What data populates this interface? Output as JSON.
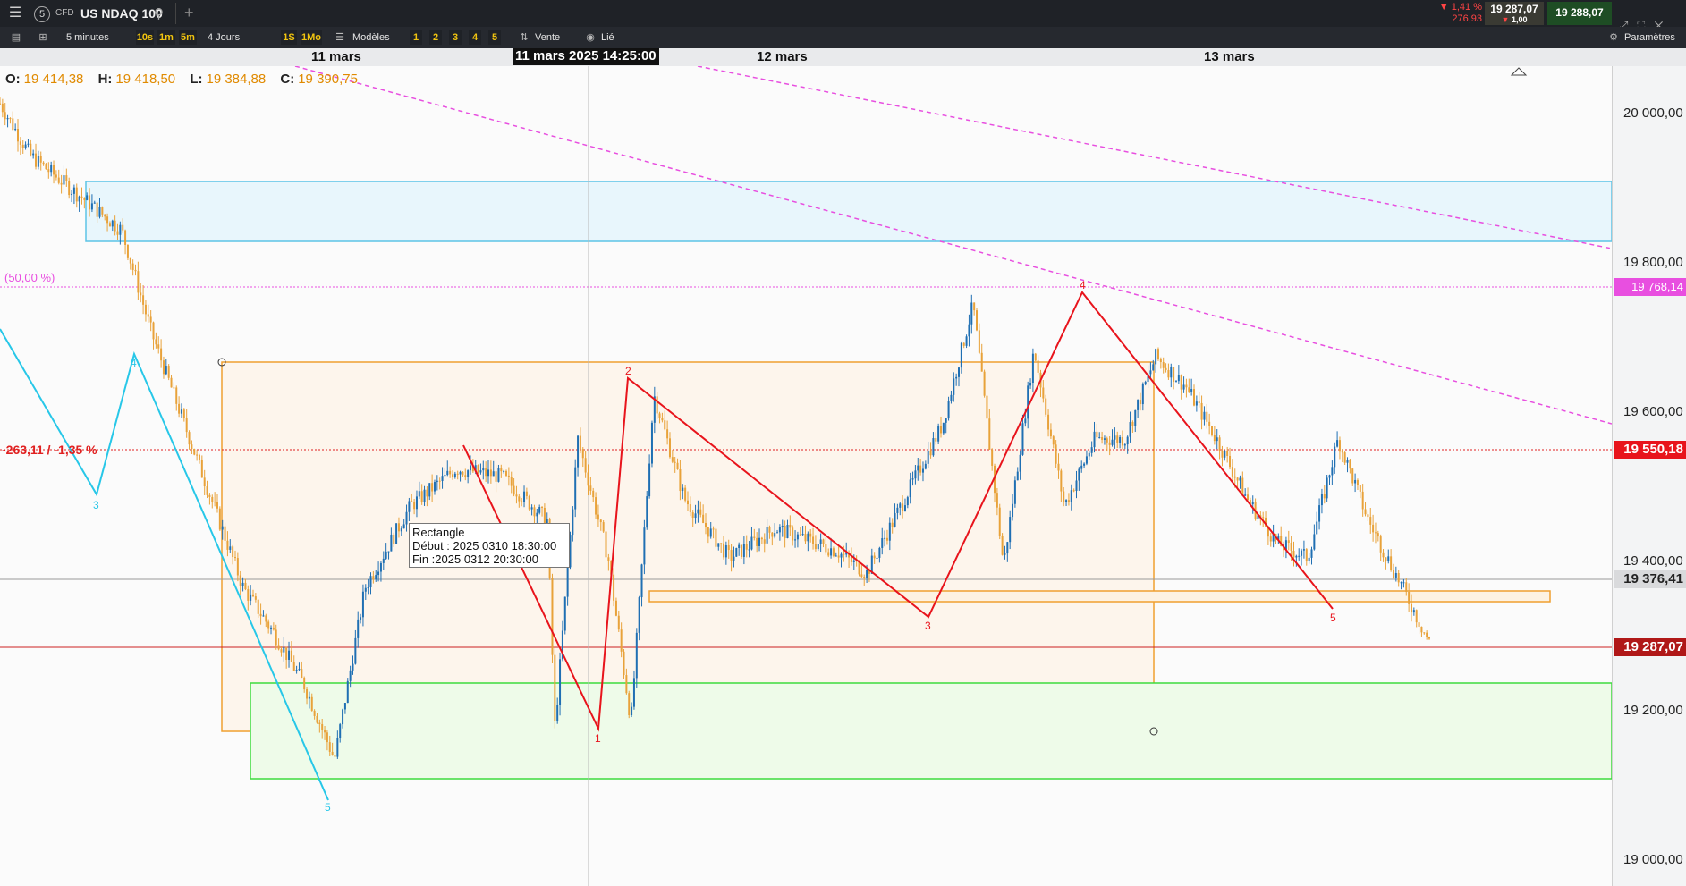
{
  "topbar": {
    "menu_icon": "hamburger-icon",
    "instrument_number": "5",
    "instrument_type": "CFD",
    "instrument_name": "US NDAQ 100",
    "search_icon": "search-icon",
    "add_tab_icon": "plus-icon",
    "change_percent": "▼ 1,41 %",
    "change_points": "276,93",
    "bid": "19 287,07",
    "bid_arrow": "▼",
    "spread": "1,00",
    "ask": "19 288,07"
  },
  "toolbar": {
    "layout_icon": "panel-icon",
    "grid_icon": "grid-icon",
    "timeframe": "5 minutes",
    "tf_buttons": [
      "10s",
      "1m",
      "5m"
    ],
    "period": "4 Jours",
    "period_buttons": [
      "1S",
      "1Mo"
    ],
    "models_label": "Modèles",
    "layout_buttons": [
      "1",
      "2",
      "3",
      "4",
      "5"
    ],
    "order_label": "Vente",
    "linked_label": "Lié",
    "settings_label": "Paramètres"
  },
  "timebar": {
    "labels": [
      "11 mars",
      "12 mars",
      "13 mars"
    ],
    "cursor_time": "11 mars 2025 14:25:00"
  },
  "ohlc": {
    "o_label": "O:",
    "o": "19 414,38",
    "h_label": "H:",
    "h": "19 418,50",
    "l_label": "L:",
    "l": "19 384,88",
    "c_label": "C:",
    "c": "19 390,75"
  },
  "annotations": {
    "fib_label": "(50,00 %)",
    "pl_label": "-263,11 / -1,35 %",
    "tooltip_title": "Rectangle",
    "tooltip_start": "Début : 2025 0310 18:30:00",
    "tooltip_end": "Fin :2025 0312 20:30:00",
    "wave_red": [
      "1",
      "2",
      "3",
      "4",
      "5"
    ],
    "wave_cyan": [
      "3",
      "4",
      "5"
    ]
  },
  "yaxis": {
    "ticks": [
      "20 000,00",
      "19 800,00",
      "19 600,00",
      "19 400,00",
      "19 200,00",
      "19 000,00"
    ],
    "flag_fib": "19 768,14",
    "flag_pl": "19 550,18",
    "flag_cross": "19 376,41",
    "flag_last": "19 287,07"
  },
  "colors": {
    "candle_up": "#1f6fb3",
    "candle_down": "#e8a23a",
    "wave_red": "#e8141c",
    "wave_cyan": "#27c7e8",
    "trendline": "#e84fe0",
    "rect_orange": "#f0a030",
    "rect_green": "#3ddb3d",
    "rect_blue": "#5cc4e6"
  },
  "chart_data": {
    "type": "candlestick",
    "instrument": "US NDAQ 100",
    "timeframe": "5 minutes",
    "x_range": [
      "2025-03-10",
      "2025-03-13"
    ],
    "ylim": [
      18960,
      20060
    ],
    "y_ticks": [
      19000,
      19200,
      19400,
      19600,
      19800,
      20000
    ],
    "price_path": [
      [
        0,
        20010
      ],
      [
        0.02,
        19940
      ],
      [
        0.05,
        19890
      ],
      [
        0.08,
        19840
      ],
      [
        0.1,
        19700
      ],
      [
        0.13,
        19530
      ],
      [
        0.16,
        19360
      ],
      [
        0.18,
        19300
      ],
      [
        0.2,
        19230
      ],
      [
        0.22,
        19130
      ],
      [
        0.24,
        19360
      ],
      [
        0.27,
        19470
      ],
      [
        0.3,
        19520
      ],
      [
        0.33,
        19510
      ],
      [
        0.36,
        19450
      ],
      [
        0.365,
        19170
      ],
      [
        0.38,
        19560
      ],
      [
        0.4,
        19400
      ],
      [
        0.415,
        19180
      ],
      [
        0.43,
        19620
      ],
      [
        0.45,
        19480
      ],
      [
        0.48,
        19400
      ],
      [
        0.51,
        19440
      ],
      [
        0.55,
        19410
      ],
      [
        0.57,
        19380
      ],
      [
        0.6,
        19500
      ],
      [
        0.62,
        19580
      ],
      [
        0.64,
        19740
      ],
      [
        0.66,
        19390
      ],
      [
        0.68,
        19680
      ],
      [
        0.7,
        19470
      ],
      [
        0.72,
        19560
      ],
      [
        0.74,
        19560
      ],
      [
        0.76,
        19670
      ],
      [
        0.78,
        19630
      ],
      [
        0.8,
        19560
      ],
      [
        0.82,
        19480
      ],
      [
        0.84,
        19420
      ],
      [
        0.86,
        19400
      ],
      [
        0.88,
        19560
      ],
      [
        0.9,
        19450
      ],
      [
        0.92,
        19370
      ],
      [
        0.94,
        19287
      ]
    ],
    "levels": {
      "fib_50": 19768.14,
      "pl_line": 19550.18,
      "crosshair": 19376.41,
      "last": 19287.07
    }
  }
}
